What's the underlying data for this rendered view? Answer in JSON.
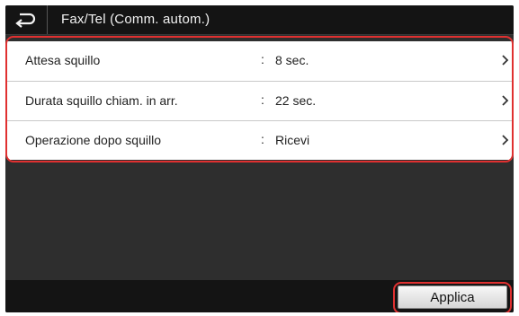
{
  "header": {
    "title": "Fax/Tel (Comm. autom.)",
    "back_icon": "back-arrow-icon"
  },
  "settings": {
    "items": [
      {
        "label": "Attesa squillo",
        "separator": ":",
        "value": "8 sec."
      },
      {
        "label": "Durata squillo chiam. in arr.",
        "separator": ":",
        "value": "22 sec."
      },
      {
        "label": "Operazione dopo squillo",
        "separator": ":",
        "value": "Ricevi"
      }
    ]
  },
  "footer": {
    "apply_label": "Applica"
  },
  "colors": {
    "highlight": "#e03030",
    "screen_bg": "#2e2e2e",
    "bar_bg": "#141414"
  }
}
